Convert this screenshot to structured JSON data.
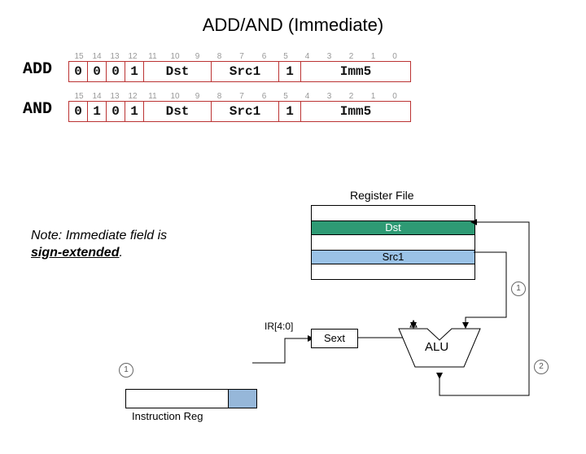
{
  "title": "ADD/AND (Immediate)",
  "bits": [
    "15",
    "14",
    "13",
    "12",
    "11",
    "10",
    "9",
    "8",
    "7",
    "6",
    "5",
    "4",
    "3",
    "2",
    "1",
    "0"
  ],
  "instructions": [
    {
      "mnemonic": "ADD",
      "opcode": [
        "0",
        "0",
        "0",
        "1"
      ],
      "dst": "Dst",
      "src": "Src1",
      "mode": "1",
      "imm": "Imm5"
    },
    {
      "mnemonic": "AND",
      "opcode": [
        "0",
        "1",
        "0",
        "1"
      ],
      "dst": "Dst",
      "src": "Src1",
      "mode": "1",
      "imm": "Imm5"
    }
  ],
  "note": {
    "prefix": "Note: Immediate field is",
    "emph": "sign-extended",
    "suffix": "."
  },
  "diagram": {
    "regfile_title": "Register File",
    "dst_label": "Dst",
    "src_label": "Src1",
    "alu_label": "ALU",
    "sext_label": "Sext",
    "ir_bits": "IR[4:0]",
    "ir_label": "Instruction Reg",
    "step1": "1",
    "step2": "2"
  }
}
